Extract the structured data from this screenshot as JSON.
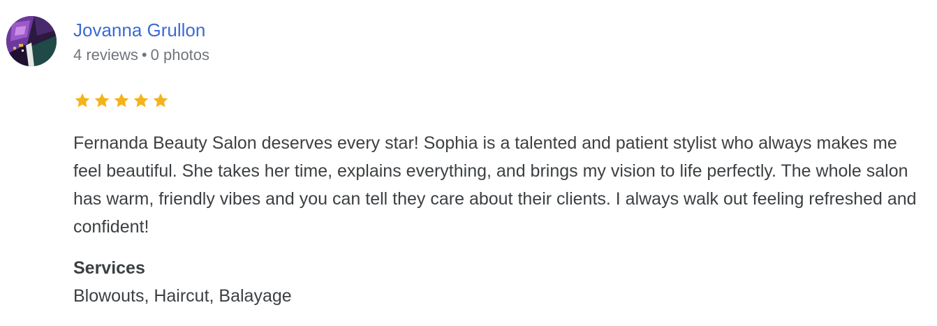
{
  "review": {
    "author": {
      "name": "Jovanna Grullon",
      "reviews_count": "4 reviews",
      "separator": "•",
      "photos_count": "0 photos",
      "avatar_icon": "profile-photo-avatar"
    },
    "rating": {
      "value": 5,
      "max": 5,
      "star_icon": "star-icon",
      "star_color": "#f5b31a"
    },
    "text": "Fernanda Beauty Salon deserves every star! Sophia is a talented and patient stylist who always makes me feel beautiful. She takes her time, explains everything, and brings my vision to life perfectly. The whole salon has warm, friendly vibes and you can tell they care about their clients. I always walk out feeling refreshed and confident!",
    "services": {
      "label": "Services",
      "value": "Blowouts, Haircut, Balayage"
    }
  },
  "colors": {
    "link": "#3b6ad6",
    "meta": "#70757a",
    "text": "#3c4043",
    "star": "#f5b31a"
  }
}
